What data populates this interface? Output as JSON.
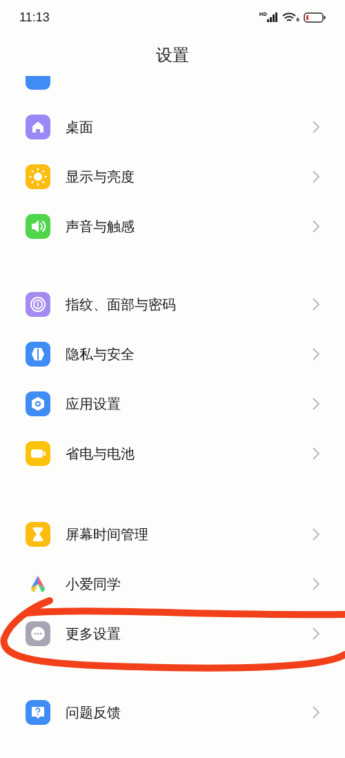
{
  "status_bar": {
    "time": "11:13",
    "network_badge": "HD",
    "wifi_badge": "6"
  },
  "header": {
    "title": "设置"
  },
  "groups": [
    {
      "items": [
        {
          "label": "桌面"
        },
        {
          "label": "显示与亮度"
        },
        {
          "label": "声音与触感"
        }
      ]
    },
    {
      "items": [
        {
          "label": "指纹、面部与密码"
        },
        {
          "label": "隐私与安全"
        },
        {
          "label": "应用设置"
        },
        {
          "label": "省电与电池"
        }
      ]
    },
    {
      "items": [
        {
          "label": "屏幕时间管理"
        },
        {
          "label": "小爱同学"
        },
        {
          "label": "更多设置"
        }
      ]
    },
    {
      "items": [
        {
          "label": "问题反馈"
        }
      ]
    }
  ],
  "annotation": {
    "kind": "ellipse"
  }
}
